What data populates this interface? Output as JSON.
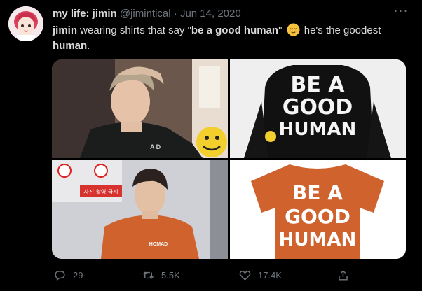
{
  "tweet": {
    "display_name": "my life: jimin",
    "handle": "@jimintical",
    "separator": "·",
    "date": "Jun 14, 2020",
    "more_label": "···",
    "text_bold_1": "jimin",
    "text_1": " wearing shirts that say \"",
    "text_bold_2": "be a good human",
    "text_2": "\" ",
    "text_3": " he's the goodest ",
    "text_bold_3": "human",
    "text_4": ".",
    "emoji": "relieved-face"
  },
  "media": {
    "images": [
      {
        "name": "photo-top-left",
        "print_text": "A D"
      },
      {
        "name": "photo-top-right",
        "print_lines": [
          "BE A",
          "GOOD",
          "HUMAN"
        ]
      },
      {
        "name": "photo-bottom-left",
        "shirt_text": "HOMAD",
        "sign_text_1": "사진 촬영 금지"
      },
      {
        "name": "photo-bottom-right",
        "print_lines": [
          "BE A",
          "GOOD",
          "HUMAN"
        ]
      }
    ]
  },
  "actions": {
    "replies": "29",
    "retweets": "5.5K",
    "likes": "17.4K"
  },
  "colors": {
    "background": "#000000",
    "text": "#d9d9d9",
    "muted": "#6e767d",
    "shirt_orange": "#d0622e"
  }
}
